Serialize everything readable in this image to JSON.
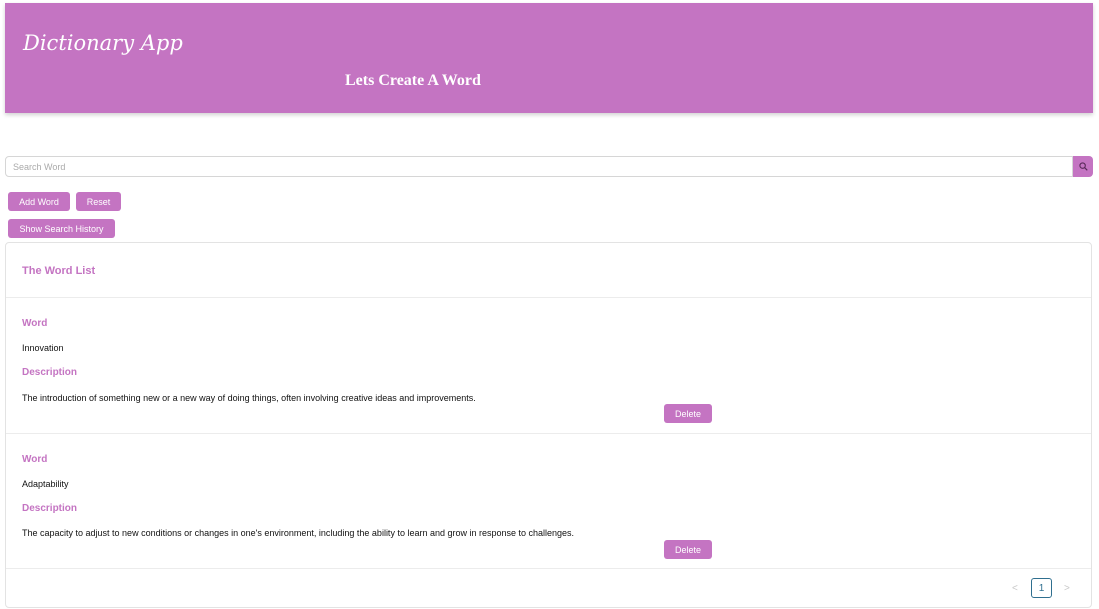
{
  "colors": {
    "brand": "#c474c2"
  },
  "header": {
    "app_title": "Dictionary App",
    "subtitle": "Lets Create A Word"
  },
  "search": {
    "placeholder": "Search Word",
    "value": "",
    "icon": "search-icon"
  },
  "actions": {
    "add_word": "Add Word",
    "reset": "Reset",
    "show_history": "Show Search History"
  },
  "word_list": {
    "title": "The Word List",
    "entries": [
      {
        "word_label": "Word",
        "word": "Innovation",
        "description_label": "Description",
        "description": "The introduction of something new or a new way of doing things, often involving creative ideas and improvements.",
        "delete_label": "Delete"
      },
      {
        "word_label": "Word",
        "word": "Adaptability",
        "description_label": "Description",
        "description": "The capacity to adjust to new conditions or changes in one's environment, including the ability to learn and grow in response to challenges.",
        "delete_label": "Delete"
      }
    ]
  },
  "pagination": {
    "prev": "<",
    "current_page": "1",
    "next": ">"
  }
}
